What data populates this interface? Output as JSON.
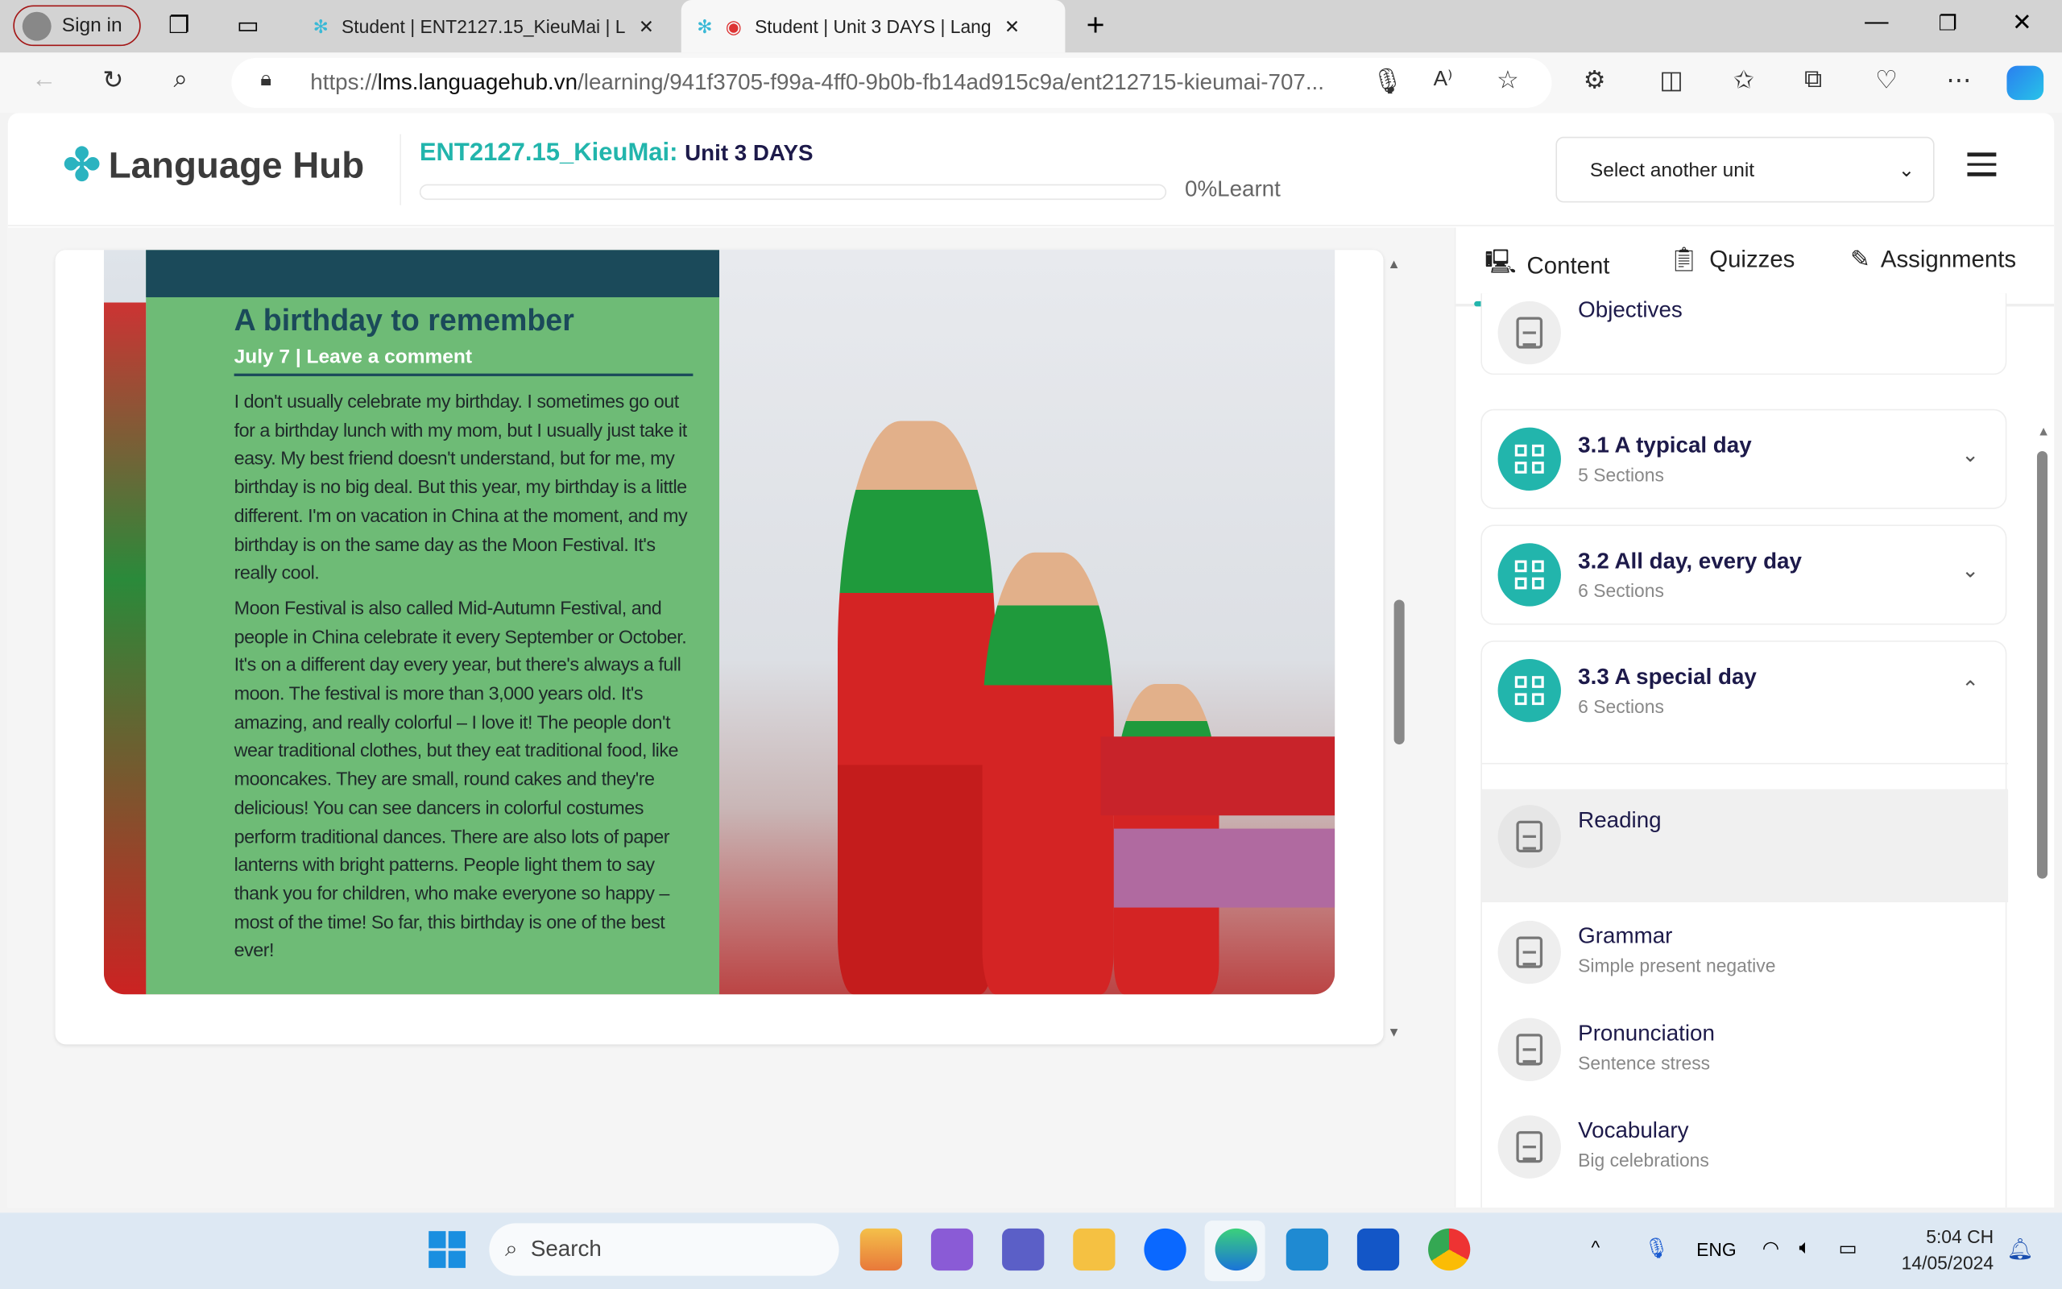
{
  "browser": {
    "sign_in": "Sign in",
    "tabs": [
      {
        "title": "Student | ENT2127.15_KieuMai | L"
      },
      {
        "title": "Student | Unit 3 DAYS | Lang"
      }
    ],
    "url_prefix": "https://",
    "url_host": "lms.languagehub.vn",
    "url_path": "/learning/941f3705-f99a-4ff0-9b0b-fb14ad915c9a/ent212715-kieumai-707..."
  },
  "header": {
    "logo": "Language Hub",
    "course_code": "ENT2127.15_KieuMai:",
    "unit": "Unit 3 DAYS",
    "progress_percent": 0,
    "progress_label": "0%Learnt",
    "select_unit": "Select another unit"
  },
  "article": {
    "title": "A birthday to remember",
    "date_line": "July 7 | Leave a comment",
    "paragraphs": [
      "I don't usually celebrate my birthday. I sometimes go out for a birthday lunch with my mom, but I usually just take it easy. My best friend doesn't understand, but for me, my birthday is no big deal. But this year, my birthday is a little different. I'm on vacation in China at the moment, and my birthday is on the same day as the Moon Festival. It's really cool.",
      "Moon Festival is also called Mid-Autumn Festival, and people in China celebrate it every September or October. It's on a different day every year, but there's always a full moon. The festival is more than 3,000 years old. It's amazing, and really colorful – I love it! The people don't wear traditional clothes, but they eat traditional food, like mooncakes. They are small, round cakes and they're delicious! You can see dancers in colorful costumes perform traditional dances. There are also lots of paper lanterns with bright patterns. People light them to say thank you for children, who make everyone so happy – most of the time! So far, this birthday is one of the best ever!"
    ]
  },
  "sidebar": {
    "tabs": [
      {
        "label": "Content",
        "active": true
      },
      {
        "label": "Quizzes"
      },
      {
        "label": "Assignments"
      }
    ],
    "items": [
      {
        "title": "Objectives"
      },
      {
        "title": "3.1 A typical day",
        "sub": "5 Sections",
        "expanded": false
      },
      {
        "title": "3.2 All day, every day",
        "sub": "6 Sections",
        "expanded": false
      },
      {
        "title": "3.3 A special day",
        "sub": "6 Sections",
        "expanded": true
      }
    ],
    "sections": [
      {
        "title": "Reading",
        "sub": "",
        "selected": true
      },
      {
        "title": "Grammar",
        "sub": "Simple present negative"
      },
      {
        "title": "Pronunciation",
        "sub": "Sentence stress"
      },
      {
        "title": "Vocabulary",
        "sub": "Big celebrations"
      }
    ],
    "accent": "#22b5ac"
  },
  "taskbar": {
    "search": "Search",
    "lang": "ENG",
    "time": "5:04 CH",
    "date": "14/05/2024"
  }
}
